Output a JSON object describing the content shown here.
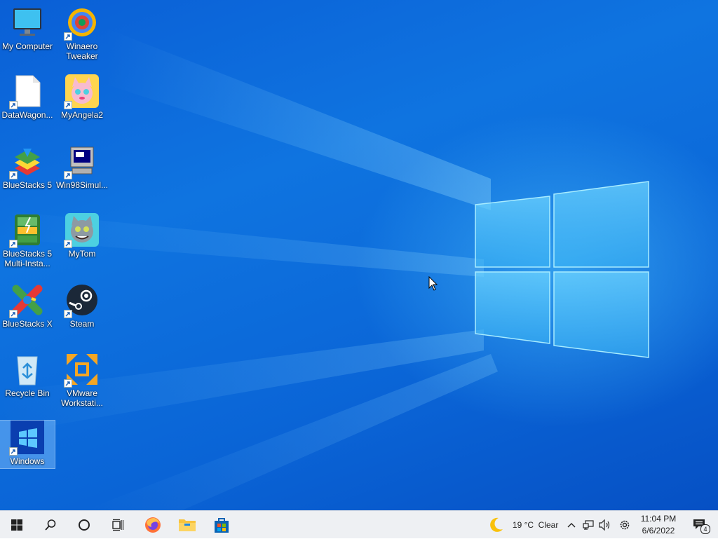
{
  "desktop": {
    "icons": [
      {
        "label": "My Computer"
      },
      {
        "label": "Winaero Tweaker"
      },
      {
        "label": "DataWagon..."
      },
      {
        "label": "MyAngela2"
      },
      {
        "label": "BlueStacks 5"
      },
      {
        "label": "Win98Simul..."
      },
      {
        "label": "BlueStacks 5 Multi-Insta..."
      },
      {
        "label": "MyTom"
      },
      {
        "label": "BlueStacks X"
      },
      {
        "label": "Steam"
      },
      {
        "label": "Recycle Bin"
      },
      {
        "label": "VMware Workstati..."
      },
      {
        "label": "Windows"
      }
    ]
  },
  "taskbar": {
    "weather": {
      "temp": "19 °C",
      "condition": "Clear"
    },
    "clock": {
      "time": "11:04 PM",
      "date": "6/6/2022"
    },
    "notifications": {
      "count": "4"
    }
  },
  "colors": {
    "desktop_blue": "#0f74e0",
    "taskbar": "#eef0f3",
    "accent": "#0078d7"
  }
}
